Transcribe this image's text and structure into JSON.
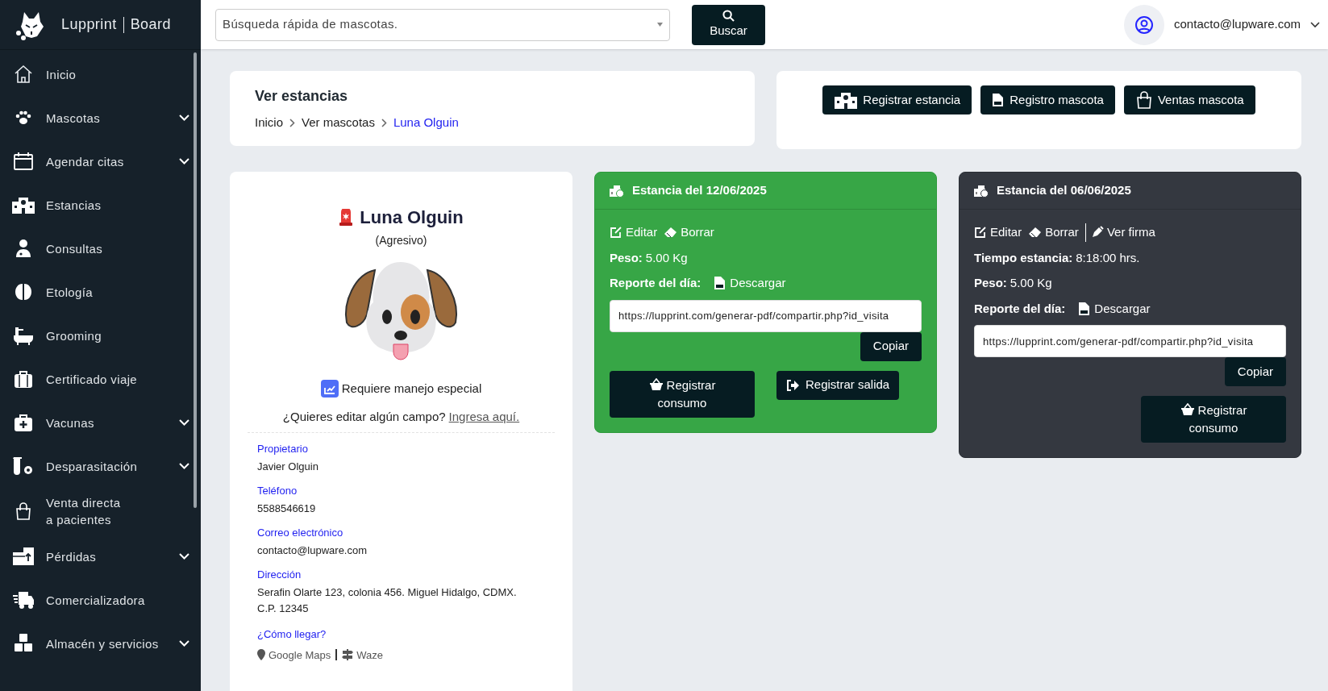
{
  "sidebar": {
    "brand": "Lupprint",
    "brand_suffix": "Board",
    "items": [
      {
        "label": "Inicio",
        "expandable": false
      },
      {
        "label": "Mascotas",
        "expandable": true
      },
      {
        "label": "Agendar citas",
        "expandable": true
      },
      {
        "label": "Estancias",
        "expandable": false
      },
      {
        "label": "Consultas",
        "expandable": false
      },
      {
        "label": "Etología",
        "expandable": false
      },
      {
        "label": "Grooming",
        "expandable": false
      },
      {
        "label": "Certificado viaje",
        "expandable": false
      },
      {
        "label": "Vacunas",
        "expandable": true
      },
      {
        "label": "Desparasitación",
        "expandable": true
      },
      {
        "label": "Venta directa\na pacientes",
        "expandable": false
      },
      {
        "label": "Pérdidas",
        "expandable": true
      },
      {
        "label": "Comercializadora",
        "expandable": false
      },
      {
        "label": "Almacén y servicios",
        "expandable": true
      }
    ]
  },
  "topbar": {
    "search": {
      "placeholder": "Búsqueda rápida de mascotas."
    },
    "search_button": "Buscar",
    "user_email": "contacto@lupware.com"
  },
  "header": {
    "title": "Ver estancias",
    "breadcrumb": [
      {
        "label": "Inicio",
        "current": false
      },
      {
        "label": "Ver mascotas",
        "current": false
      },
      {
        "label": "Luna Olguin",
        "current": true
      }
    ]
  },
  "actions": [
    "Registrar estancia",
    "Registro mascota",
    "Ventas mascota"
  ],
  "pet": {
    "name": "Luna Olguin",
    "temperament": "(Agresivo)",
    "special_handling": "Requiere manejo especial",
    "edit_prompt": "¿Quieres editar algún campo?",
    "edit_link": "Ingresa aquí.",
    "fields": [
      {
        "label": "Propietario",
        "value": "Javier Olguin"
      },
      {
        "label": "Teléfono",
        "value": "5588546619"
      },
      {
        "label": "Correo electrónico",
        "value": "contacto@lupware.com"
      },
      {
        "label": "Dirección",
        "value": "Serafin Olarte 123, colonia 456. Miguel Hidalgo, CDMX.\nC.P. 12345"
      }
    ],
    "directions": {
      "label": "¿Cómo llegar?",
      "links": [
        "Google Maps",
        "Waze"
      ]
    }
  },
  "stays": [
    {
      "title": "Estancia del 12/06/2025",
      "active": true,
      "actions": [
        {
          "label": "Editar",
          "separator_before": false
        },
        {
          "label": "Borrar",
          "separator_before": false
        }
      ],
      "details": [
        {
          "label": "Peso:",
          "value": "5.00 Kg"
        }
      ],
      "report_label": "Reporte del día:",
      "report_link": "Descargar",
      "share_url": "https://lupprint.com/generar-pdf/compartir.php?id_visita",
      "copy_button": "Copiar",
      "buttons": [
        "Registrar consumo",
        "Registrar salida"
      ]
    },
    {
      "title": "Estancia del 06/06/2025",
      "active": false,
      "actions": [
        {
          "label": "Editar",
          "separator_before": false
        },
        {
          "label": "Borrar",
          "separator_before": false
        },
        {
          "label": "Ver firma",
          "separator_before": true
        }
      ],
      "details": [
        {
          "label": "Tiempo estancia:",
          "value": "8:18:00 hrs."
        },
        {
          "label": "Peso:",
          "value": "5.00 Kg"
        }
      ],
      "report_label": "Reporte del día:",
      "report_link": "Descargar",
      "share_url": "https://lupprint.com/generar-pdf/compartir.php?id_visita",
      "copy_button": "Copiar",
      "buttons": [
        "Registrar consumo"
      ]
    }
  ]
}
